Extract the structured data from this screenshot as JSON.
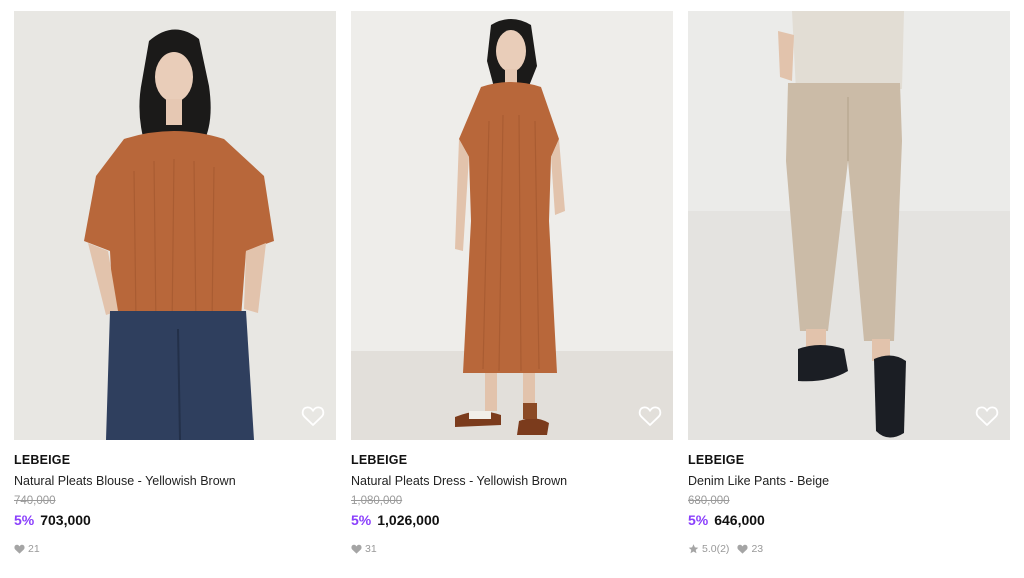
{
  "products": [
    {
      "brand": "LEBEIGE",
      "name": "Natural Pleats Blouse - Yellowish Brown",
      "original_price": "740,000",
      "discount": "5%",
      "price": "703,000",
      "likes": "21",
      "photo": "woman-in-brown-pleated-blouse-and-dark-denim"
    },
    {
      "brand": "LEBEIGE",
      "name": "Natural Pleats Dress - Yellowish Brown",
      "original_price": "1,080,000",
      "discount": "5%",
      "price": "1,026,000",
      "likes": "31",
      "photo": "woman-in-brown-pleated-midi-dress-and-sandals"
    },
    {
      "brand": "LEBEIGE",
      "name": "Denim Like Pants - Beige",
      "original_price": "680,000",
      "discount": "5%",
      "price": "646,000",
      "rating": "5.0(2)",
      "likes": "23",
      "photo": "beige-wide-pants-with-black-clogs"
    }
  ],
  "colors": {
    "discount": "#8a3ffc",
    "muted": "#9a9a9a",
    "icon": "#a5a5a5"
  },
  "icons": {
    "wishlist": "heart-outline-icon",
    "likes": "heart-filled-icon",
    "rating": "star-icon"
  }
}
